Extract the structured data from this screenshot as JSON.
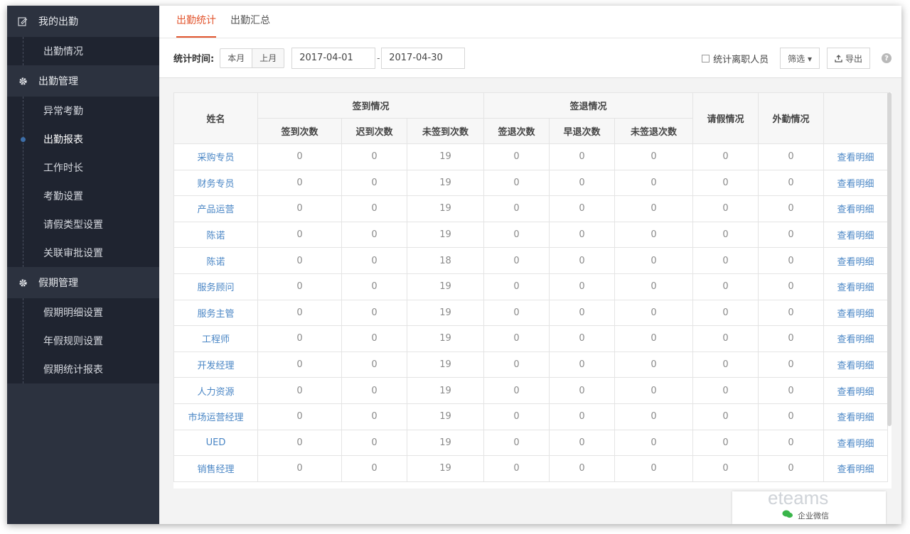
{
  "sidebar": {
    "groups": [
      {
        "label": "我的出勤",
        "icon": "edit-icon",
        "items": [
          {
            "label": "出勤情况"
          }
        ]
      },
      {
        "label": "出勤管理",
        "icon": "gear-icon",
        "items": [
          {
            "label": "异常考勤"
          },
          {
            "label": "出勤报表",
            "active": true
          },
          {
            "label": "工作时长"
          },
          {
            "label": "考勤设置"
          },
          {
            "label": "请假类型设置"
          },
          {
            "label": "关联审批设置"
          }
        ]
      },
      {
        "label": "假期管理",
        "icon": "gear-icon",
        "items": [
          {
            "label": "假期明细设置"
          },
          {
            "label": "年假规则设置"
          },
          {
            "label": "假期统计报表"
          }
        ]
      }
    ]
  },
  "tabs": [
    {
      "label": "出勤统计",
      "active": true
    },
    {
      "label": "出勤汇总"
    }
  ],
  "toolbar": {
    "time_label": "统计时间:",
    "this_month": "本月",
    "last_month": "上月",
    "start_date": "2017-04-01",
    "date_sep": "-",
    "end_date": "2017-04-30",
    "include_left_label": "统计离职人员",
    "filter_label": "筛选 ▾",
    "export_label": "导出",
    "help_label": "?"
  },
  "table": {
    "headers": {
      "name": "姓名",
      "signin_group": "签到情况",
      "signout_group": "签退情况",
      "leave": "请假情况",
      "outwork": "外勤情况",
      "sub": [
        "签到次数",
        "迟到次数",
        "未签到次数",
        "签退次数",
        "早退次数",
        "未签退次数"
      ]
    },
    "detail_label": "查看明细",
    "rows": [
      {
        "name": "采购专员",
        "cells": [
          "0",
          "0",
          "19",
          "0",
          "0",
          "0",
          "0",
          "0"
        ]
      },
      {
        "name": "财务专员",
        "cells": [
          "0",
          "0",
          "19",
          "0",
          "0",
          "0",
          "0",
          "0"
        ]
      },
      {
        "name": "产品运营",
        "cells": [
          "0",
          "0",
          "19",
          "0",
          "0",
          "0",
          "0",
          "0"
        ]
      },
      {
        "name": "陈诺",
        "cells": [
          "0",
          "0",
          "19",
          "0",
          "0",
          "0",
          "0",
          "0"
        ]
      },
      {
        "name": "陈诺",
        "cells": [
          "0",
          "0",
          "18",
          "0",
          "0",
          "0",
          "0",
          "0"
        ]
      },
      {
        "name": "服务顾问",
        "cells": [
          "0",
          "0",
          "19",
          "0",
          "0",
          "0",
          "0",
          "0"
        ]
      },
      {
        "name": "服务主管",
        "cells": [
          "0",
          "0",
          "19",
          "0",
          "0",
          "0",
          "0",
          "0"
        ]
      },
      {
        "name": "工程师",
        "cells": [
          "0",
          "0",
          "19",
          "0",
          "0",
          "0",
          "0",
          "0"
        ]
      },
      {
        "name": "开发经理",
        "cells": [
          "0",
          "0",
          "19",
          "0",
          "0",
          "0",
          "0",
          "0"
        ]
      },
      {
        "name": "人力资源",
        "cells": [
          "0",
          "0",
          "19",
          "0",
          "0",
          "0",
          "0",
          "0"
        ]
      },
      {
        "name": "市场运营经理",
        "cells": [
          "0",
          "0",
          "19",
          "0",
          "0",
          "0",
          "0",
          "0"
        ]
      },
      {
        "name": "UED",
        "cells": [
          "0",
          "0",
          "19",
          "0",
          "0",
          "0",
          "0",
          "0"
        ]
      },
      {
        "name": "销售经理",
        "cells": [
          "0",
          "0",
          "19",
          "0",
          "0",
          "0",
          "0",
          "0"
        ]
      }
    ]
  },
  "watermark": {
    "brand": "eteams",
    "caption": "企业微信"
  },
  "colors": {
    "accent": "#e2552e",
    "link": "#4a86c5",
    "sidebar_bg": "#2c323f"
  }
}
